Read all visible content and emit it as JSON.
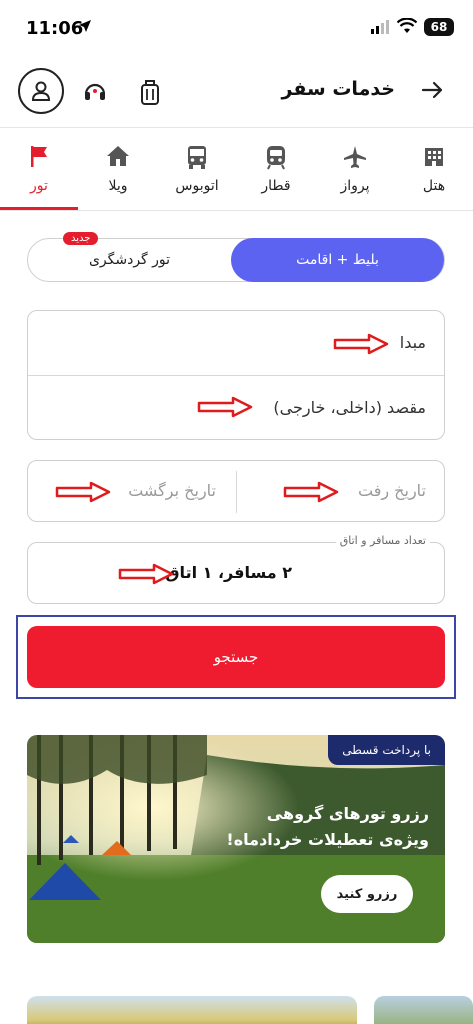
{
  "status": {
    "time": "11:06",
    "battery": "68"
  },
  "header": {
    "title": "خدمات سفر"
  },
  "tabs": [
    {
      "label": "هتل",
      "icon": "hotel-icon"
    },
    {
      "label": "پرواز",
      "icon": "plane-icon"
    },
    {
      "label": "قطار",
      "icon": "train-icon"
    },
    {
      "label": "اتوبوس",
      "icon": "bus-icon"
    },
    {
      "label": "ویلا",
      "icon": "home-icon"
    },
    {
      "label": "تور",
      "icon": "flag-icon",
      "active": true
    }
  ],
  "tour_type": {
    "option_active": "بلیط + اقامت",
    "option_other": "تور گردشگری",
    "badge": "جدید"
  },
  "form": {
    "origin_placeholder": "مبدا",
    "destination_placeholder": "مقصد (داخلی، خارجی)",
    "depart_placeholder": "تاریخ رفت",
    "return_placeholder": "تاریخ برگشت",
    "passengers_legend": "تعداد مسافر و اتاق",
    "passengers_value": "۲ مسافر، ۱ اتاق"
  },
  "search": {
    "label": "جستجو"
  },
  "banner": {
    "tag": "با پرداخت قسطی",
    "title_line1": "رزرو تورهای گروهی",
    "title_line2": "ویژه‌ی تعطیلات خردادماه!",
    "button": "رزرو کنید"
  },
  "colors": {
    "brand": "#ee1c2e",
    "accent": "#5c63f0",
    "outline": "#3c45a8"
  }
}
